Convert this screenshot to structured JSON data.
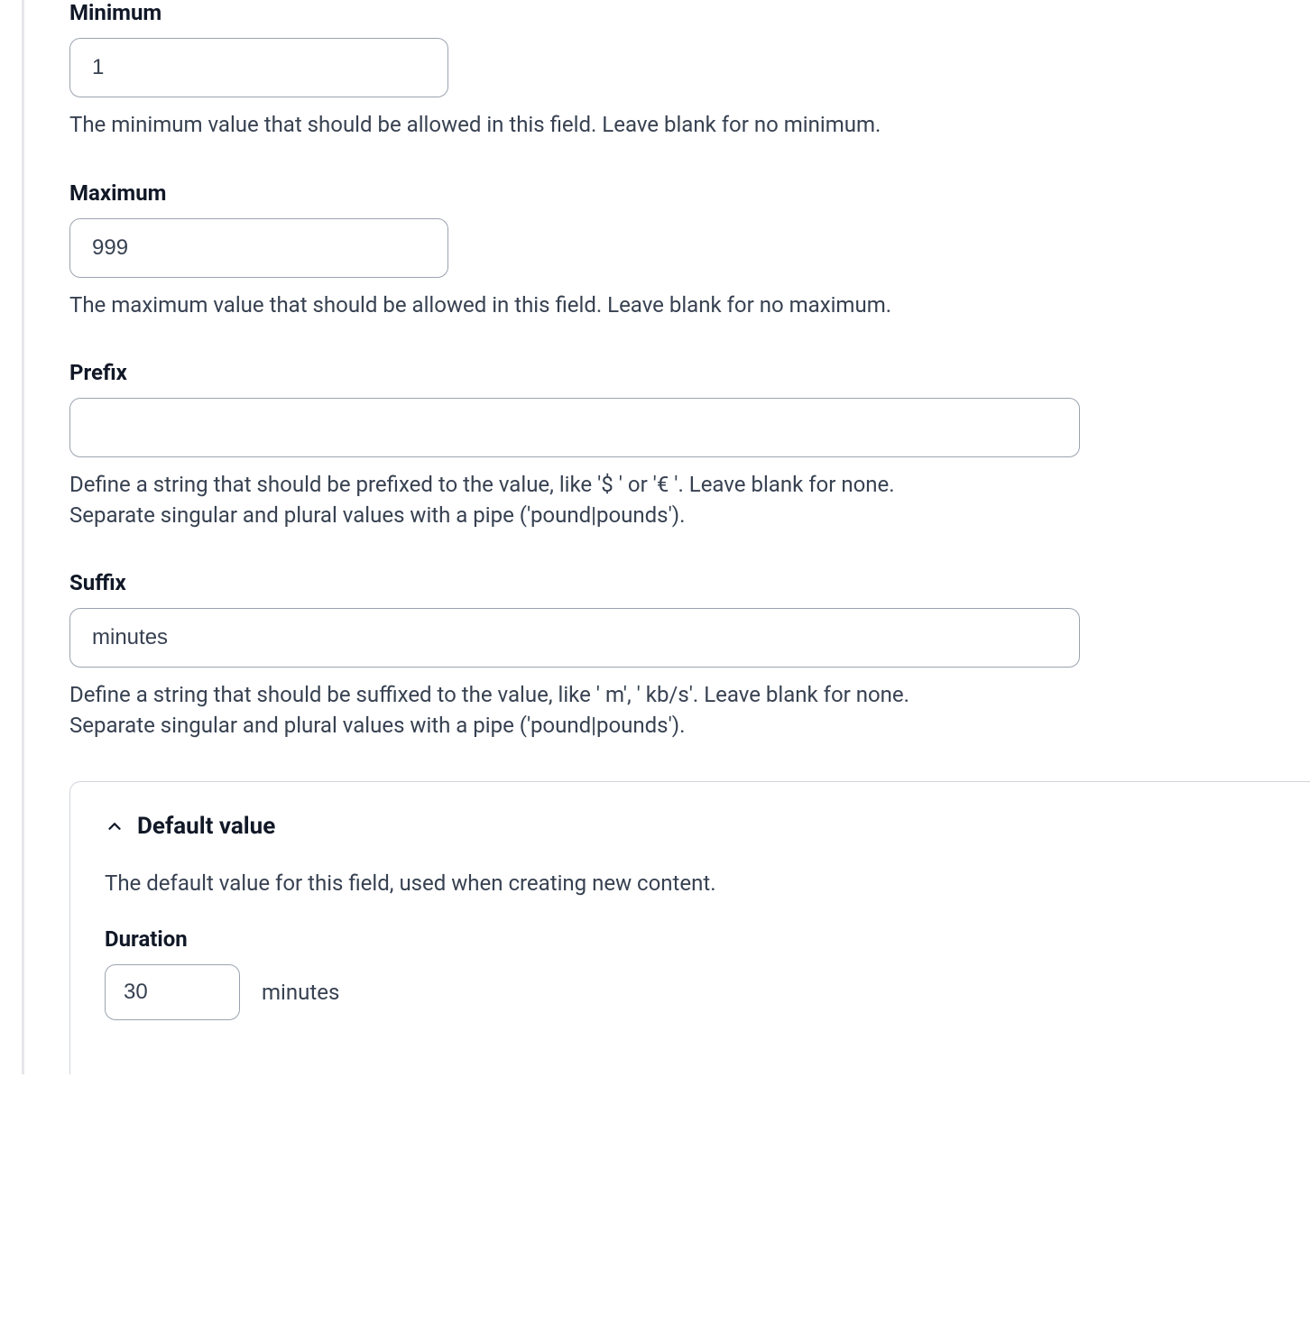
{
  "minimum": {
    "label": "Minimum",
    "value": "1",
    "help": "The minimum value that should be allowed in this field. Leave blank for no minimum."
  },
  "maximum": {
    "label": "Maximum",
    "value": "999",
    "help": "The maximum value that should be allowed in this field. Leave blank for no maximum."
  },
  "prefix": {
    "label": "Prefix",
    "value": "",
    "help": "Define a string that should be prefixed to the value, like '$ ' or '€ '. Leave blank for none. Separate singular and plural values with a pipe ('pound|pounds')."
  },
  "suffix": {
    "label": "Suffix",
    "value": "minutes",
    "help": "Define a string that should be suffixed to the value, like ' m', ' kb/s'. Leave blank for none. Separate singular and plural values with a pipe ('pound|pounds')."
  },
  "defaultPanel": {
    "title": "Default value",
    "description": "The default value for this field, used when creating new content.",
    "duration": {
      "label": "Duration",
      "value": "30",
      "suffix": "minutes"
    }
  }
}
